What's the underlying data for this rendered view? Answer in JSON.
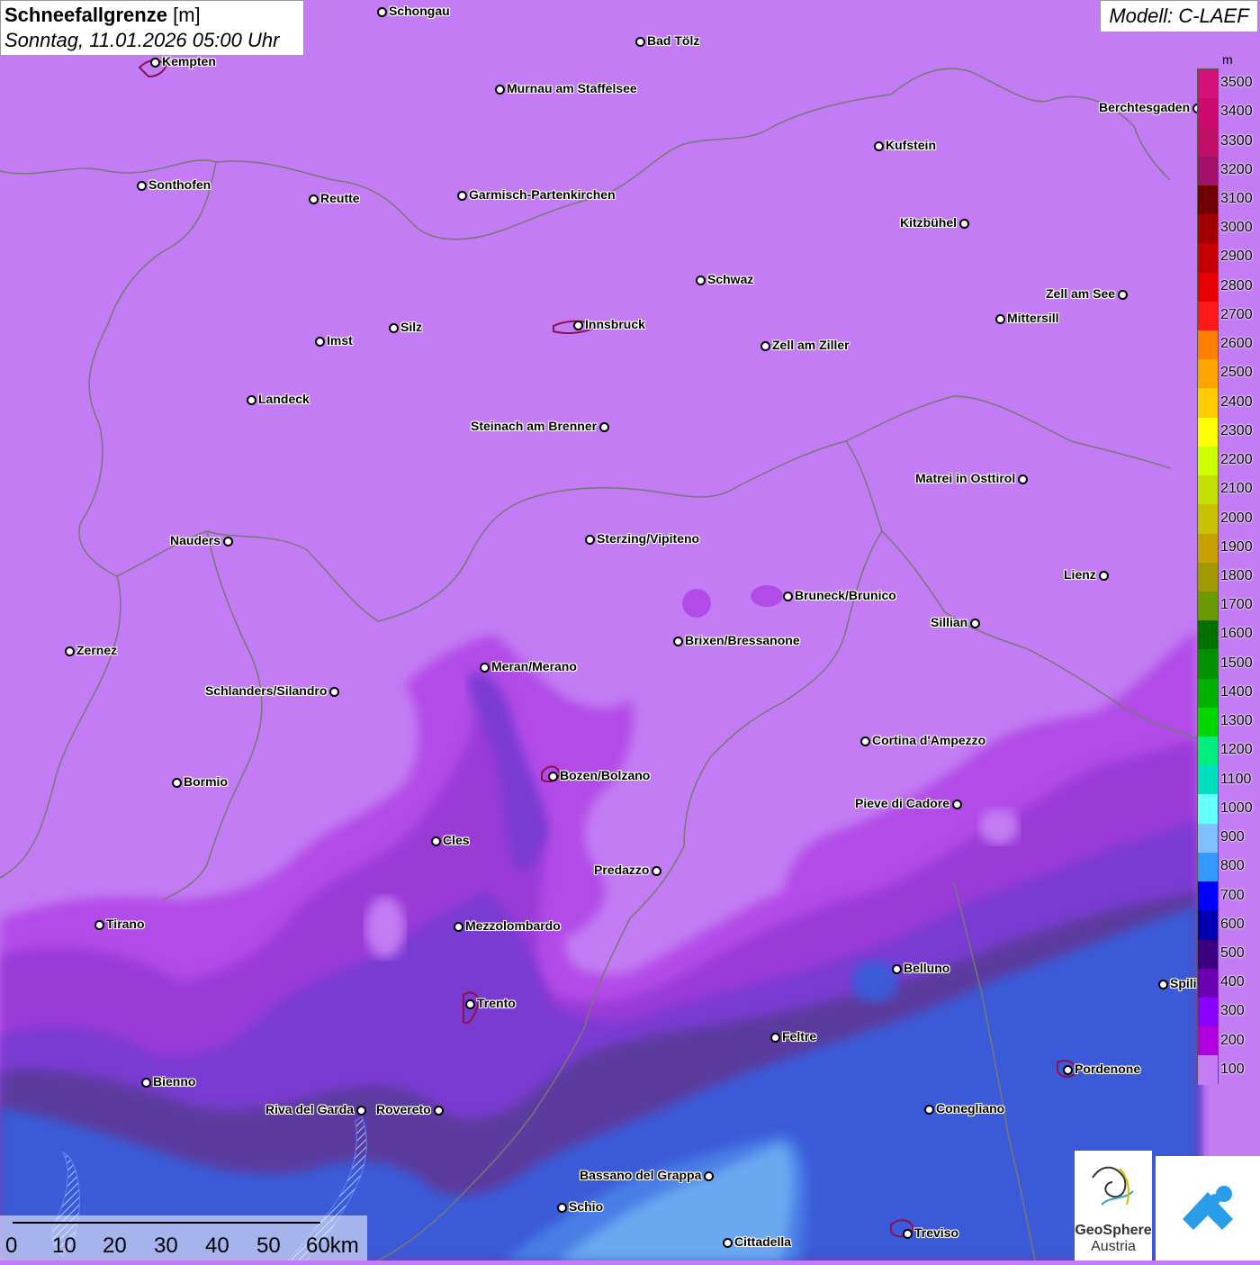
{
  "title": {
    "param": "Schneefallgrenze",
    "unit": "[m]",
    "datetime": "Sonntag, 11.01.2026 05:00 Uhr"
  },
  "model": "Modell: C-LAEF",
  "legend": {
    "unit": "m",
    "entries": [
      {
        "label": "3500",
        "color": "#d5127a"
      },
      {
        "label": "3400",
        "color": "#cc0a6e"
      },
      {
        "label": "3300",
        "color": "#c00f66"
      },
      {
        "label": "3200",
        "color": "#a1106b"
      },
      {
        "label": "3100",
        "color": "#6e0000"
      },
      {
        "label": "3000",
        "color": "#a00000"
      },
      {
        "label": "2900",
        "color": "#c40000"
      },
      {
        "label": "2800",
        "color": "#e60000"
      },
      {
        "label": "2700",
        "color": "#ff1a1a"
      },
      {
        "label": "2600",
        "color": "#ff8000"
      },
      {
        "label": "2500",
        "color": "#ffa500"
      },
      {
        "label": "2400",
        "color": "#ffcc00"
      },
      {
        "label": "2300",
        "color": "#ffff00"
      },
      {
        "label": "2200",
        "color": "#ccff00"
      },
      {
        "label": "2100",
        "color": "#c4e000"
      },
      {
        "label": "2000",
        "color": "#c8c000"
      },
      {
        "label": "1900",
        "color": "#c8a000"
      },
      {
        "label": "1800",
        "color": "#a09a00"
      },
      {
        "label": "1700",
        "color": "#6a9a00"
      },
      {
        "label": "1600",
        "color": "#007000"
      },
      {
        "label": "1500",
        "color": "#009000"
      },
      {
        "label": "1400",
        "color": "#00b000"
      },
      {
        "label": "1300",
        "color": "#00d800"
      },
      {
        "label": "1200",
        "color": "#00ee80"
      },
      {
        "label": "1100",
        "color": "#00e0c0"
      },
      {
        "label": "1000",
        "color": "#66ffff"
      },
      {
        "label": "900",
        "color": "#80c0ff"
      },
      {
        "label": "800",
        "color": "#3399ff"
      },
      {
        "label": "700",
        "color": "#0000ff"
      },
      {
        "label": "600",
        "color": "#0000b0"
      },
      {
        "label": "500",
        "color": "#3a0080"
      },
      {
        "label": "400",
        "color": "#6a00b0"
      },
      {
        "label": "300",
        "color": "#8a00ff"
      },
      {
        "label": "200",
        "color": "#b000e0"
      },
      {
        "label": "100",
        "color": "#c37cf3"
      }
    ]
  },
  "scale": {
    "labels": [
      "0",
      "10",
      "20",
      "30",
      "40",
      "50",
      "60km"
    ]
  },
  "logos": {
    "geosphere_line1": "GeoSphere",
    "geosphere_line2": "Austria"
  },
  "cities": [
    {
      "name": "Schongau",
      "side": "right"
    },
    {
      "name": "Bad Tölz",
      "side": "right"
    },
    {
      "name": "Kempten",
      "side": "right"
    },
    {
      "name": "Murnau am Staffelsee",
      "side": "right"
    },
    {
      "name": "Berchtesgaden",
      "side": "left"
    },
    {
      "name": "Kufstein",
      "side": "right"
    },
    {
      "name": "Sonthofen",
      "side": "right"
    },
    {
      "name": "Reutte",
      "side": "right"
    },
    {
      "name": "Garmisch-Partenkirchen",
      "side": "right"
    },
    {
      "name": "Kitzbühel",
      "side": "left"
    },
    {
      "name": "Schwaz",
      "side": "right"
    },
    {
      "name": "Zell am See",
      "side": "left"
    },
    {
      "name": "Mittersill",
      "side": "right"
    },
    {
      "name": "Innsbruck",
      "side": "right"
    },
    {
      "name": "Silz",
      "side": "right"
    },
    {
      "name": "Imst",
      "side": "right"
    },
    {
      "name": "Zell am Ziller",
      "side": "right"
    },
    {
      "name": "Landeck",
      "side": "right"
    },
    {
      "name": "Steinach am Brenner",
      "side": "left"
    },
    {
      "name": "Matrei in Osttirol",
      "side": "left"
    },
    {
      "name": "Nauders",
      "side": "left"
    },
    {
      "name": "Sterzing/Vipiteno",
      "side": "right"
    },
    {
      "name": "Lienz",
      "side": "left"
    },
    {
      "name": "Bruneck/Brunico",
      "side": "right"
    },
    {
      "name": "Sillian",
      "side": "left"
    },
    {
      "name": "Brixen/Bressanone",
      "side": "right"
    },
    {
      "name": "Zernez",
      "side": "right"
    },
    {
      "name": "Meran/Merano",
      "side": "right"
    },
    {
      "name": "Schlanders/Silandro",
      "side": "left"
    },
    {
      "name": "Cortina d'Ampezzo",
      "side": "right"
    },
    {
      "name": "Bozen/Bolzano",
      "side": "right"
    },
    {
      "name": "Bormio",
      "side": "right"
    },
    {
      "name": "Pieve di Cadore",
      "side": "left"
    },
    {
      "name": "Cles",
      "side": "right"
    },
    {
      "name": "Predazzo",
      "side": "left"
    },
    {
      "name": "Tirano",
      "side": "right"
    },
    {
      "name": "Mezzolombardo",
      "side": "right"
    },
    {
      "name": "Belluno",
      "side": "right"
    },
    {
      "name": "Spili",
      "side": "right"
    },
    {
      "name": "Trento",
      "side": "right"
    },
    {
      "name": "Feltre",
      "side": "right"
    },
    {
      "name": "Pordenone",
      "side": "right"
    },
    {
      "name": "Bienno",
      "side": "right"
    },
    {
      "name": "Riva del Garda",
      "side": "left"
    },
    {
      "name": "Rovereto",
      "side": "left"
    },
    {
      "name": "Conegliano",
      "side": "right"
    },
    {
      "name": "Bassano del Grappa",
      "side": "left"
    },
    {
      "name": "Schio",
      "side": "right"
    },
    {
      "name": "Treviso",
      "side": "right"
    },
    {
      "name": "Cittadella",
      "side": "right"
    }
  ]
}
